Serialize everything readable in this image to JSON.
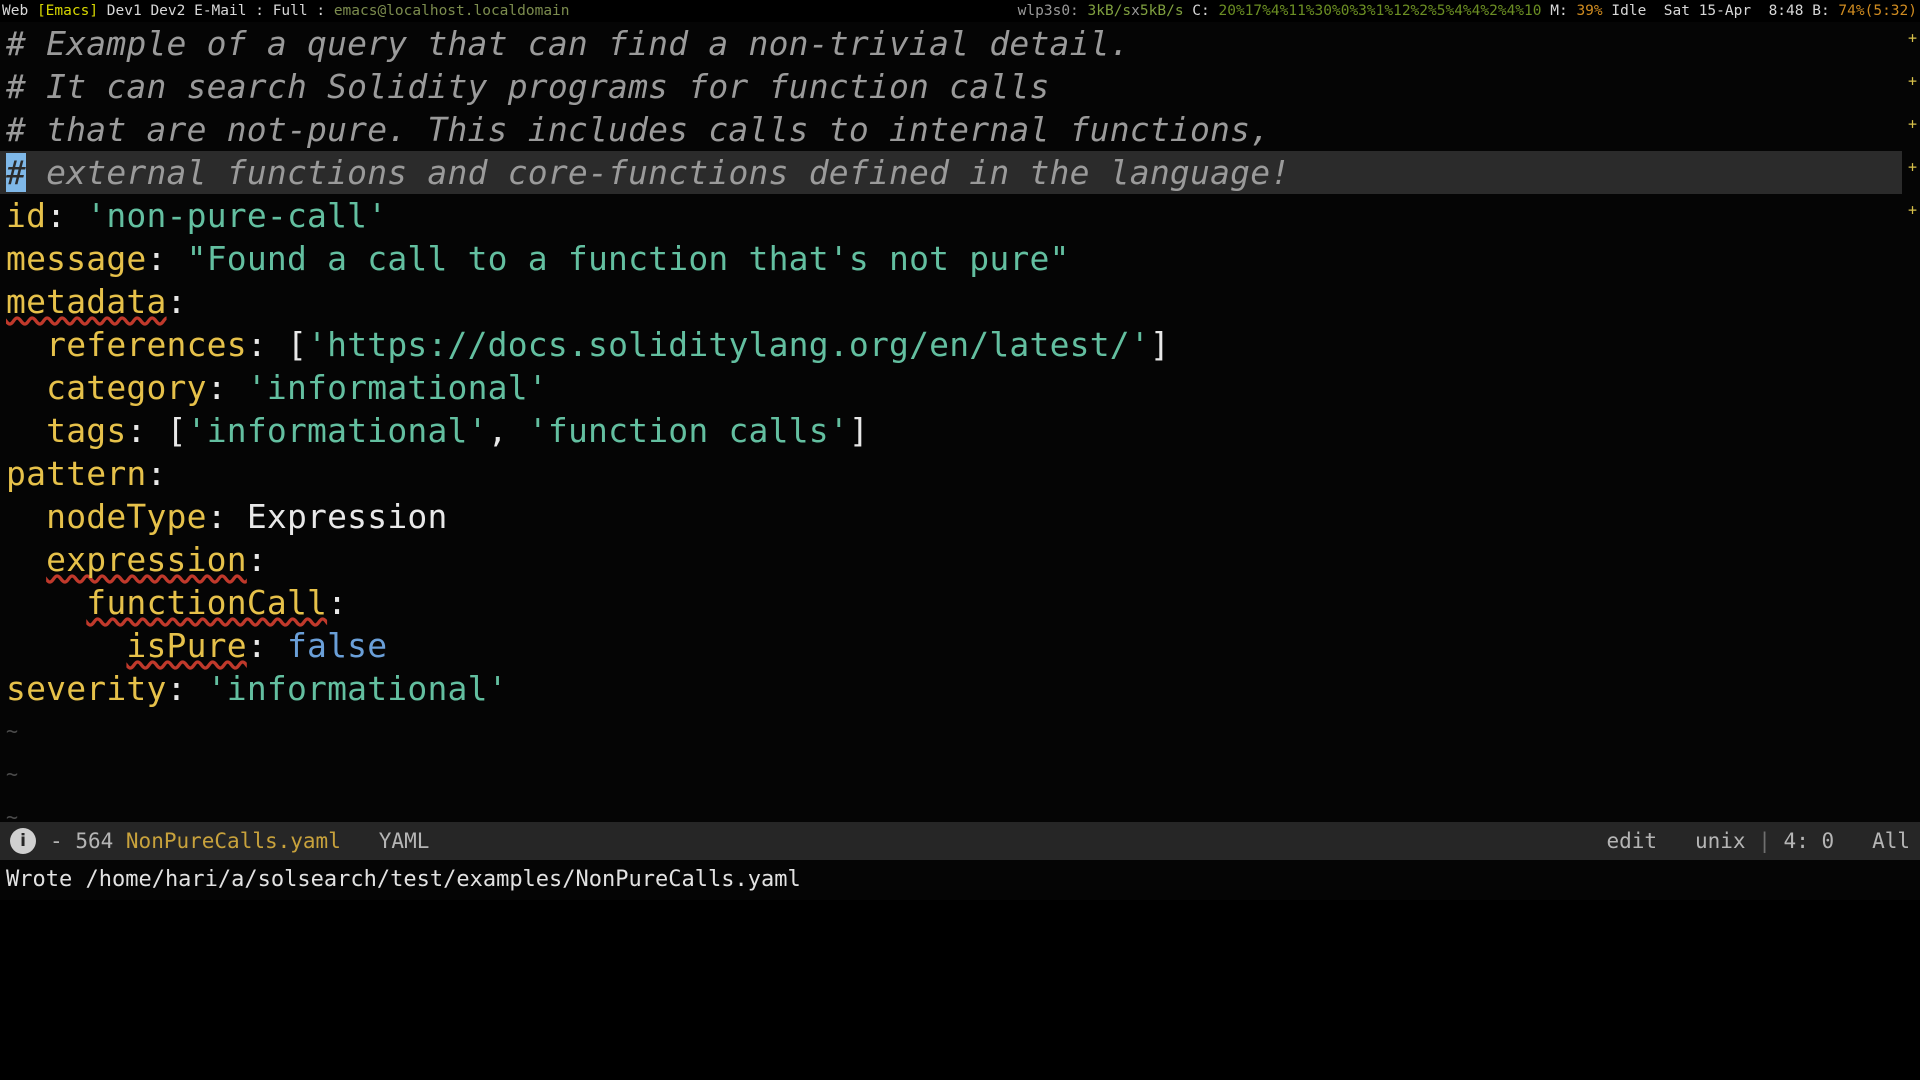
{
  "topbar": {
    "session_label": "Web",
    "windows": [
      {
        "name": "[Emacs]",
        "active": true
      },
      {
        "name": "Dev1",
        "active": false
      },
      {
        "name": "Dev2",
        "active": false
      },
      {
        "name": "E-Mail",
        "active": false
      }
    ],
    "sep1": ":",
    "pane_mode": "Full",
    "sep2": ":",
    "host": "emacs@localhost.localdomain",
    "net_iface": "wlp3s0:",
    "net_down": "3kB/s",
    "net_x": "x",
    "net_up": "5kB/s",
    "cpu_label": "C:",
    "cpu_values": "20%17%4%11%30%0%3%1%12%2%5%4%4%2%4%10",
    "mem_label": "M:",
    "mem_value": "39%",
    "idle": "Idle",
    "date": "Sat 15-Apr",
    "time": "8:48",
    "battery_label": "B:",
    "battery_value": "74%(5:32)",
    "colors": {
      "active_window": "#d7d700",
      "net_value": "#7f9f3f",
      "cpu_value": "#6b8e23",
      "mem_value": "#cf8b20",
      "battery_value": "#cf8b20",
      "host": "#7c8c4e"
    }
  },
  "editor": {
    "cursor_char": "#",
    "cursor_line_index": 3,
    "lines": [
      {
        "type": "comment",
        "text": "# Example of a query that can find a non-trivial detail."
      },
      {
        "type": "comment",
        "text": "# It can search Solidity programs for function calls"
      },
      {
        "type": "comment",
        "text": "# that are not-pure. This includes calls to internal functions,"
      },
      {
        "type": "comment",
        "text": "# external functions and core-functions defined in the language!",
        "highlighted": true
      },
      {
        "type": "yaml",
        "key": "id",
        "value": "'non-pure-call'",
        "indent": 0,
        "value_kind": "string"
      },
      {
        "type": "yaml",
        "key": "message",
        "value": "\"Found a call to a function that's not pure\"",
        "indent": 0,
        "value_kind": "string"
      },
      {
        "type": "yaml",
        "key": "metadata",
        "value": "",
        "indent": 0,
        "value_kind": "none",
        "misspelled": true
      },
      {
        "type": "yaml",
        "key": "references",
        "value": "['https://docs.soliditylang.org/en/latest/']",
        "indent": 2,
        "value_kind": "list"
      },
      {
        "type": "yaml",
        "key": "category",
        "value": "'informational'",
        "indent": 2,
        "value_kind": "string"
      },
      {
        "type": "yaml",
        "key": "tags",
        "value": "['informational', 'function calls']",
        "indent": 2,
        "value_kind": "list"
      },
      {
        "type": "yaml",
        "key": "pattern",
        "value": "",
        "indent": 0,
        "value_kind": "none"
      },
      {
        "type": "yaml",
        "key": "nodeType",
        "value": "Expression",
        "indent": 2,
        "value_kind": "plain"
      },
      {
        "type": "yaml",
        "key": "expression",
        "value": "",
        "indent": 2,
        "value_kind": "none",
        "misspelled": true
      },
      {
        "type": "yaml",
        "key": "functionCall",
        "value": "",
        "indent": 4,
        "value_kind": "none",
        "misspelled": true
      },
      {
        "type": "yaml",
        "key": "isPure",
        "value": "false",
        "indent": 6,
        "value_kind": "boolean",
        "misspelled": true
      },
      {
        "type": "yaml",
        "key": "severity",
        "value": "'informational'",
        "indent": 0,
        "value_kind": "string"
      }
    ],
    "empty_markers": [
      "~",
      "~",
      "~"
    ],
    "fringe_marker": "+"
  },
  "modeline": {
    "status_icon": "i",
    "modified_indicator": "-",
    "line_count": "564",
    "file_name": "NonPureCalls.yaml",
    "major_mode": "YAML",
    "state": "edit",
    "encoding": "unix",
    "separator": "|",
    "position": "4: 0",
    "scroll": "All"
  },
  "echo": {
    "message": "Wrote /home/hari/a/solsearch/test/examples/NonPureCalls.yaml"
  }
}
